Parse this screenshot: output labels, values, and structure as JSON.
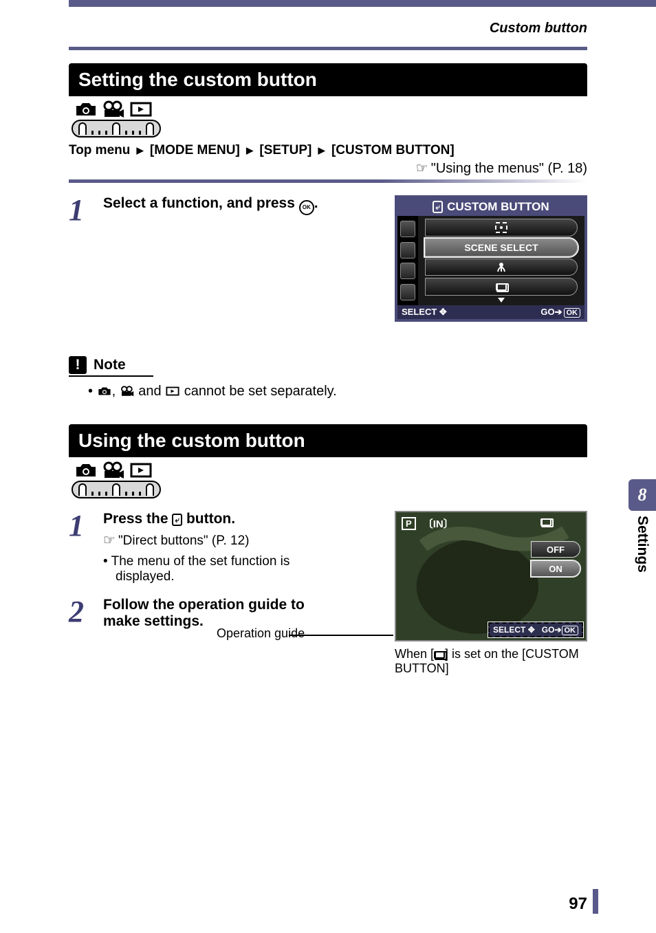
{
  "header": {
    "breadcrumb": "Custom button"
  },
  "section1": {
    "title": "Setting the custom button",
    "path": {
      "prefix": "Top menu",
      "items": [
        "[MODE MENU]",
        "[SETUP]",
        "[CUSTOM BUTTON]"
      ]
    },
    "ref": "\"Using the menus\" (P. 18)",
    "step1_num": "1",
    "step1_text_pre": "Select a function, and press ",
    "step1_text_post": ".",
    "ok_label": "OK"
  },
  "screenshot1": {
    "title": "CUSTOM BUTTON",
    "opt_selected": "SCENE SELECT",
    "foot_left": "SELECT",
    "foot_right_prefix": "GO",
    "foot_ok": "OK"
  },
  "note": {
    "label": "Note",
    "text_mid": " and ",
    "text_end": " cannot be set separately."
  },
  "section2": {
    "title": "Using the custom button",
    "step1_num": "1",
    "step1_text_pre": "Press the ",
    "step1_text_post": " button.",
    "step1_ref": "\"Direct buttons\" (P. 12)",
    "step1_bullet": "The menu of the set function is displayed.",
    "step2_num": "2",
    "step2_text": "Follow the operation guide to make settings.",
    "op_guide_label": "Operation guide"
  },
  "screenshot2": {
    "p": "P",
    "in": "IN",
    "off": "OFF",
    "on": "ON",
    "foot_left": "SELECT",
    "foot_right_prefix": "GO",
    "foot_ok": "OK",
    "caption_pre": "When [",
    "caption_post": "] is set on the [CUSTOM BUTTON]"
  },
  "side": {
    "chapter": "8",
    "label": "Settings"
  },
  "page": "97"
}
